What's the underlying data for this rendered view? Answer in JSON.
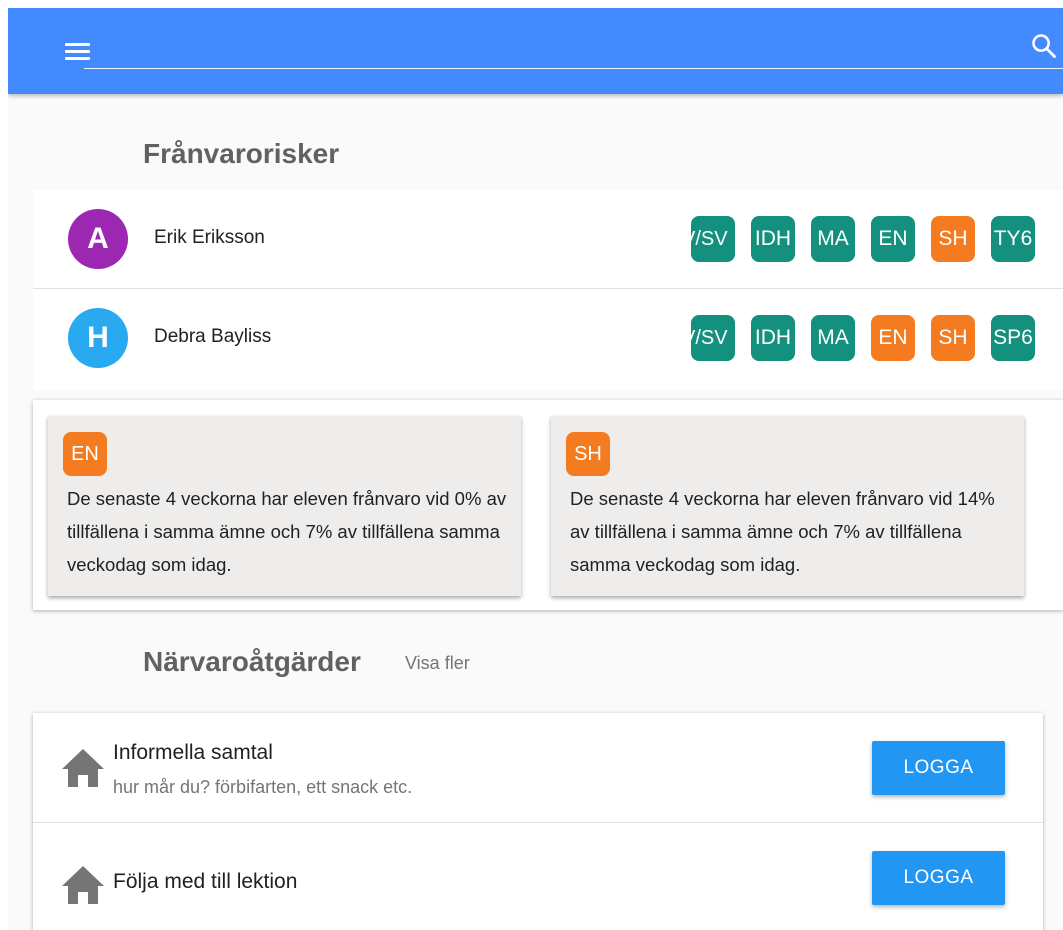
{
  "colors": {
    "appbar": "#448aff",
    "teal": "#14907f",
    "orange": "#f47b20",
    "button": "#2196f3"
  },
  "appbar": {
    "menu_icon": "hamburger-menu-icon",
    "search_icon": "search-icon",
    "search_value": ""
  },
  "risks": {
    "title": "Frånvarorisker",
    "students": [
      {
        "initial": "A",
        "avatar_color": "#9c27b0",
        "name": "Erik Eriksson",
        "subjects": [
          {
            "label": "V/SV",
            "color": "#14907f"
          },
          {
            "label": "IDH",
            "color": "#14907f"
          },
          {
            "label": "MA",
            "color": "#14907f"
          },
          {
            "label": "EN",
            "color": "#14907f"
          },
          {
            "label": "SH",
            "color": "#f47b20"
          },
          {
            "label": "TY6",
            "color": "#14907f"
          }
        ]
      },
      {
        "initial": "H",
        "avatar_color": "#29a9ef",
        "name": "Debra Bayliss",
        "subjects": [
          {
            "label": "V/SV",
            "color": "#14907f"
          },
          {
            "label": "IDH",
            "color": "#14907f"
          },
          {
            "label": "MA",
            "color": "#14907f"
          },
          {
            "label": "EN",
            "color": "#f47b20"
          },
          {
            "label": "SH",
            "color": "#f47b20"
          },
          {
            "label": "SP6",
            "color": "#14907f"
          }
        ]
      }
    ],
    "details": [
      {
        "subject": "EN",
        "color": "#f47b20",
        "text": "De senaste 4 veckorna har eleven frånvaro vid 0% av tillfällena i samma ämne och 7% av tillfällena samma veckodag som idag."
      },
      {
        "subject": "SH",
        "color": "#f47b20",
        "text": "De senaste 4 veckorna har eleven frånvaro vid 14% av tillfällena i samma ämne och 7% av tillfällena samma veckodag som idag."
      }
    ]
  },
  "actions": {
    "title": "Närvaroåtgärder",
    "more_label": "Visa fler",
    "items": [
      {
        "icon": "home-icon",
        "title": "Informella samtal",
        "description": "hur mår du? förbifarten, ett snack etc.",
        "button_label": "LOGGA"
      },
      {
        "icon": "home-icon",
        "title": "Följa med till lektion",
        "description": "",
        "button_label": "LOGGA"
      }
    ]
  }
}
